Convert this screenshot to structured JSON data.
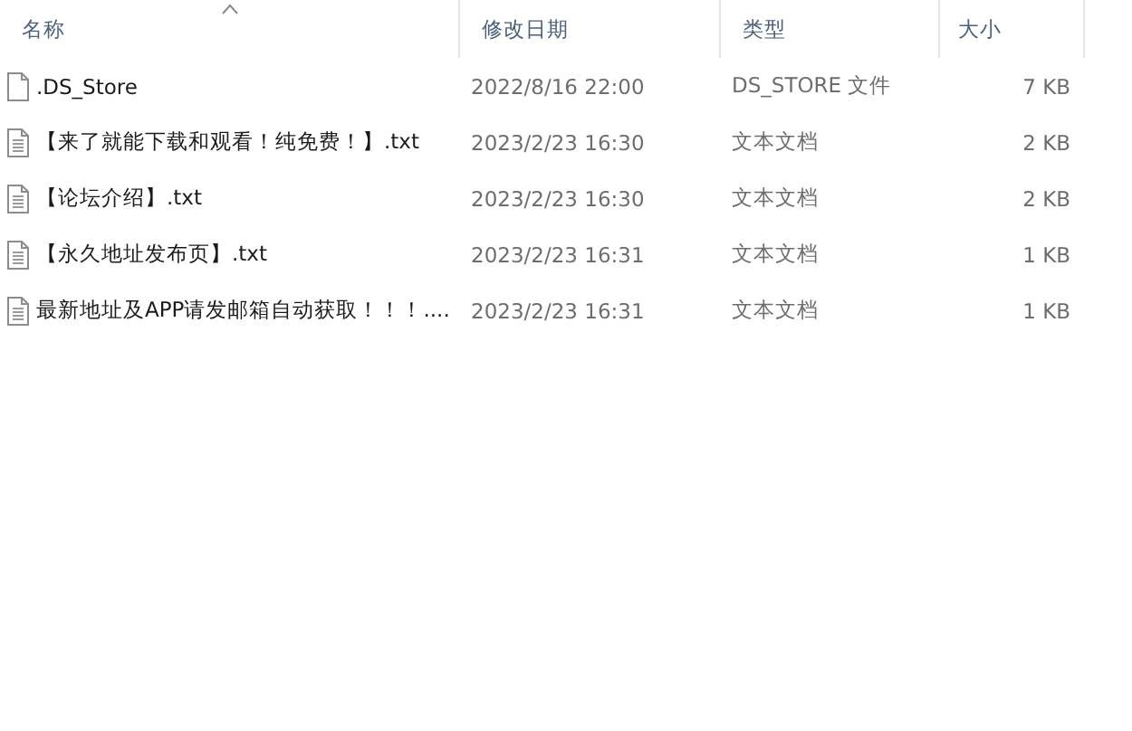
{
  "columns": [
    {
      "label": "名称",
      "sorted": true
    },
    {
      "label": "修改日期",
      "sorted": false
    },
    {
      "label": "类型",
      "sorted": false
    },
    {
      "label": "大小",
      "sorted": false
    }
  ],
  "files": [
    {
      "kind": "blank",
      "name": ".DS_Store",
      "modified": "2022/8/16 22:00",
      "type": "DS_STORE 文件",
      "size": "7 KB"
    },
    {
      "kind": "text",
      "name": "【来了就能下载和观看！纯免费！】.txt",
      "modified": "2023/2/23 16:30",
      "type": "文本文档",
      "size": "2 KB"
    },
    {
      "kind": "text",
      "name": "【论坛介绍】.txt",
      "modified": "2023/2/23 16:30",
      "type": "文本文档",
      "size": "2 KB"
    },
    {
      "kind": "text",
      "name": "【永久地址发布页】.txt",
      "modified": "2023/2/23 16:31",
      "type": "文本文档",
      "size": "1 KB"
    },
    {
      "kind": "text",
      "name": "最新地址及APP请发邮箱自动获取！！！....",
      "modified": "2023/2/23 16:31",
      "type": "文本文档",
      "size": "1 KB"
    }
  ]
}
